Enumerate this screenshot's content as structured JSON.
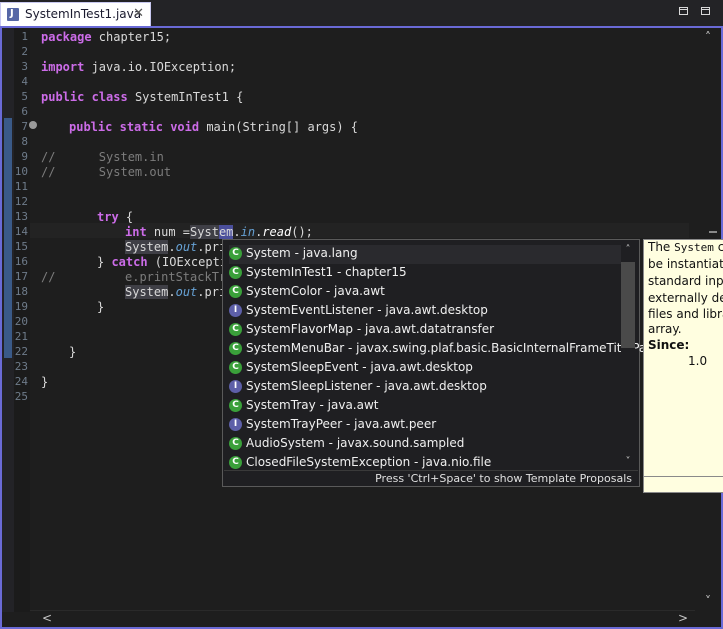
{
  "tab": {
    "title": "SystemInTest1.java",
    "close": "✕",
    "icon": "java-file-icon"
  },
  "code_lines": [
    {
      "n": "1"
    },
    {
      "n": "2"
    },
    {
      "n": "3"
    },
    {
      "n": "4"
    },
    {
      "n": "5"
    },
    {
      "n": "6"
    },
    {
      "n": "7"
    },
    {
      "n": "8"
    },
    {
      "n": "9"
    },
    {
      "n": "10"
    },
    {
      "n": "11"
    },
    {
      "n": "12"
    },
    {
      "n": "13"
    },
    {
      "n": "14"
    },
    {
      "n": "15"
    },
    {
      "n": "16"
    },
    {
      "n": "17"
    },
    {
      "n": "18"
    },
    {
      "n": "19"
    },
    {
      "n": "20"
    },
    {
      "n": "21"
    },
    {
      "n": "22"
    },
    {
      "n": "23"
    },
    {
      "n": "24"
    },
    {
      "n": "25"
    }
  ],
  "code": {
    "l1_kw": "package",
    "l1_rest": " chapter15;",
    "l3_kw": "import",
    "l3_rest": " java.io.IOException;",
    "l5_kw1": "public",
    "l5_kw2": "class",
    "l5_rest": " SystemInTest1 {",
    "l7_kw1": "public",
    "l7_kw2": "static",
    "l7_kw3": "void",
    "l7_rest": " main(String[] args) {",
    "l9": "//      System.in",
    "l10": "//      System.out",
    "l13_kw": "try",
    "l13_rest": " {",
    "l14_kw": "int",
    "l14_a": " num =",
    "l14_b": "Syst",
    "l14_c": "em",
    "l14_d": ".",
    "l14_e": "in",
    "l14_f": ".",
    "l14_g": "read",
    "l14_h": "();",
    "l15_a": "System",
    "l15_b": ".",
    "l15_c": "out",
    "l15_d": ".pri",
    "l16_a": "} ",
    "l16_kw": "catch",
    "l16_b": " (IOExcepti",
    "l17_a": "//",
    "l17_b": "e.printStackTr",
    "l18_a": "System",
    "l18_b": ".",
    "l18_c": "out",
    "l18_d": ".pri",
    "l19": "}",
    "l22": "}",
    "l24": "}"
  },
  "completion": {
    "items": [
      {
        "kind": "class",
        "badge": "C",
        "label": "System - java.lang"
      },
      {
        "kind": "class",
        "badge": "C",
        "label": "SystemInTest1 - chapter15"
      },
      {
        "kind": "class",
        "badge": "C",
        "label": "SystemColor - java.awt"
      },
      {
        "kind": "iface",
        "badge": "I",
        "label": "SystemEventListener - java.awt.desktop"
      },
      {
        "kind": "class",
        "badge": "C",
        "label": "SystemFlavorMap - java.awt.datatransfer"
      },
      {
        "kind": "class",
        "badge": "C",
        "label": "SystemMenuBar - javax.swing.plaf.basic.BasicInternalFrameTitlePane"
      },
      {
        "kind": "class",
        "badge": "C",
        "label": "SystemSleepEvent - java.awt.desktop"
      },
      {
        "kind": "iface",
        "badge": "I",
        "label": "SystemSleepListener - java.awt.desktop"
      },
      {
        "kind": "class",
        "badge": "C",
        "label": "SystemTray - java.awt"
      },
      {
        "kind": "iface",
        "badge": "I",
        "label": "SystemTrayPeer - java.awt.peer"
      },
      {
        "kind": "class",
        "badge": "C",
        "label": "AudioSystem - javax.sound.sampled"
      },
      {
        "kind": "class",
        "badge": "C",
        "label": "ClosedFileSystemException - java.nio.file"
      }
    ],
    "footer": "Press 'Ctrl+Space' to show Template Proposals"
  },
  "javadoc": {
    "l1a": "The ",
    "l1b": "System",
    "l1c": " c",
    "l2": "be instantiated",
    "l3": "standard input",
    "l4": "externally defi",
    "l5": "files and librar",
    "l6": "array.",
    "since_label": "Since:",
    "since_value": "1.0"
  },
  "scroll": {
    "up": "˄",
    "down": "˅",
    "left": "<",
    "right": ">"
  }
}
